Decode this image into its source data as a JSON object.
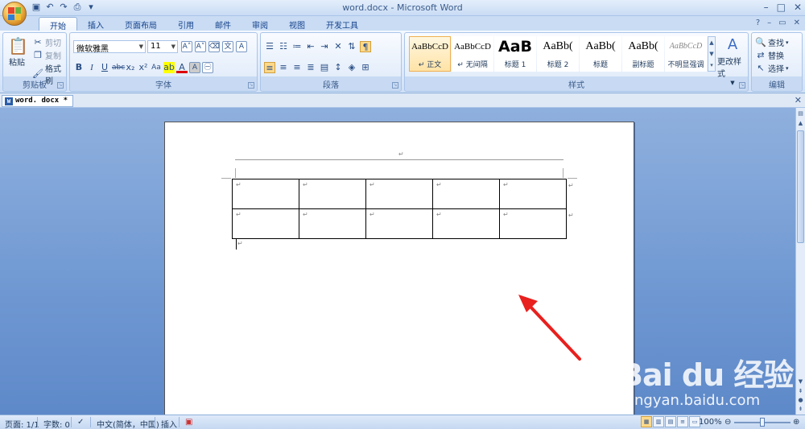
{
  "window": {
    "title": "word.docx - Microsoft Word"
  },
  "qat": {
    "icons": [
      "save-icon",
      "undo-icon",
      "redo-icon",
      "print-preview-icon",
      "customize-qat-icon"
    ]
  },
  "tabs": [
    "开始",
    "插入",
    "页面布局",
    "引用",
    "邮件",
    "审阅",
    "视图",
    "开发工具"
  ],
  "active_tab": "开始",
  "ribbon": {
    "clipboard": {
      "label": "剪贴板",
      "paste": "粘贴",
      "cut": "剪切",
      "copy": "复制",
      "format_painter": "格式刷"
    },
    "font": {
      "label": "字体",
      "font_name": "微软雅黑",
      "font_size": "11"
    },
    "paragraph": {
      "label": "段落"
    },
    "styles": {
      "label": "样式",
      "items": [
        {
          "sample": "AaBbCcD",
          "name": "↵ 正文"
        },
        {
          "sample": "AaBbCcD",
          "name": "↵ 无间隔"
        },
        {
          "sample": "AaB",
          "name": "标题 1"
        },
        {
          "sample": "AaBb(",
          "name": "标题 2"
        },
        {
          "sample": "AaBb(",
          "name": "标题"
        },
        {
          "sample": "AaBb(",
          "name": "副标题"
        },
        {
          "sample": "AaBbCcD",
          "name": "不明显强调"
        }
      ],
      "change_styles": "更改样式"
    },
    "editing": {
      "label": "编辑",
      "find": "查找",
      "replace": "替换",
      "select": "选择"
    }
  },
  "doc_tab": {
    "name": "word. docx *"
  },
  "document": {
    "header_mark": "↵",
    "table": {
      "rows": [
        [
          "↵",
          "↵",
          "↵",
          "↵",
          "↵"
        ],
        [
          "↵",
          "↵",
          "↵",
          "↵",
          "↵"
        ]
      ],
      "row_end_marks": [
        "↵",
        "↵"
      ]
    },
    "after_table_mark": "↵"
  },
  "status": {
    "page": "页面: 1/1",
    "words": "字数: 0",
    "language": "中文(简体，中国)",
    "mode": "插入",
    "zoom": "100%"
  },
  "watermark": {
    "main": "Bai du 经验",
    "sub": "jingyan.baidu.com"
  },
  "colors": {
    "ribbon": "#dfeafa",
    "workspace": "#6f98d2",
    "arrow": "#e8201e"
  }
}
